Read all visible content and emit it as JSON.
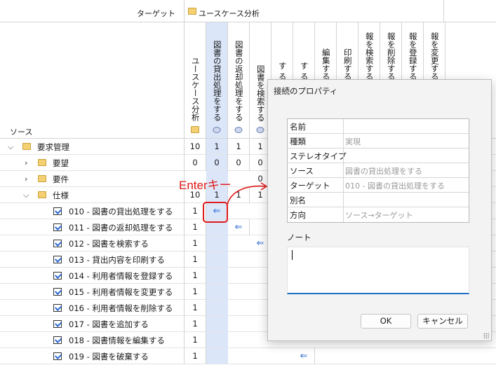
{
  "header": {
    "target_label": "ターゲット",
    "usecase_group": "ユースケース分析",
    "source_label": "ソース"
  },
  "columns": [
    {
      "label": "ユースケース分析",
      "icon": "folder-icon"
    },
    {
      "label": "図書の貸出処理をする",
      "icon": "ellipse-icon"
    },
    {
      "label": "図書の返却処理をする",
      "icon": "ellipse-icon"
    },
    {
      "label": "図書を検索する",
      "icon": "ellipse-icon"
    },
    {
      "label": "す る",
      "icon": ""
    },
    {
      "label": "す る",
      "icon": ""
    },
    {
      "label": "編集する",
      "icon": ""
    },
    {
      "label": "印刷する",
      "icon": ""
    },
    {
      "label": "報を検索する",
      "icon": ""
    },
    {
      "label": "報を削除する",
      "icon": ""
    },
    {
      "label": "報を登録する",
      "icon": ""
    },
    {
      "label": "報を変更する",
      "icon": ""
    }
  ],
  "tree": {
    "root": {
      "label": "要求管理",
      "values": [
        "10",
        "1",
        "1",
        "1"
      ]
    },
    "youbou": {
      "label": "要望",
      "values": [
        "0",
        "0",
        "0",
        "0"
      ]
    },
    "youken": {
      "label": "要件",
      "values": [
        "",
        "",
        "",
        "0"
      ]
    },
    "shiyou": {
      "label": "仕様",
      "values": [
        "10",
        "1",
        "1",
        "1"
      ]
    }
  },
  "rows": [
    {
      "label": "010 - 図書の貸出処理をする",
      "count": "1"
    },
    {
      "label": "011 - 図書の返却処理をする",
      "count": "1"
    },
    {
      "label": "012 - 図書を検索する",
      "count": "1"
    },
    {
      "label": "013 - 貸出内容を印刷する",
      "count": "1"
    },
    {
      "label": "014 - 利用者情報を登録する",
      "count": "1"
    },
    {
      "label": "015 - 利用者情報を変更する",
      "count": "1"
    },
    {
      "label": "016 - 利用者情報を削除する",
      "count": "1"
    },
    {
      "label": "017 - 図書を追加する",
      "count": "1"
    },
    {
      "label": "018 - 図書情報を編集する",
      "count": "1"
    },
    {
      "label": "019 - 図書を破棄する",
      "count": "1"
    }
  ],
  "annotation": {
    "enter_label": "Enterキー"
  },
  "dialog": {
    "title": "接続のプロパティ",
    "props": [
      {
        "key": "名前",
        "value": ""
      },
      {
        "key": "種類",
        "value": "実現"
      },
      {
        "key": "ステレオタイプ",
        "value": ""
      },
      {
        "key": "ソース",
        "value": "図書の貸出処理をする"
      },
      {
        "key": "ターゲット",
        "value": "010 - 図書の貸出処理をする"
      },
      {
        "key": "別名",
        "value": ""
      },
      {
        "key": "方向",
        "value": "ソース→ターゲット"
      }
    ],
    "note_label": "ノート",
    "ok_label": "OK",
    "cancel_label": "キャンセル"
  },
  "colors": {
    "accent": "#2c6bd1",
    "highlight": "#dbe6f9",
    "annotation": "#e01b1b"
  }
}
